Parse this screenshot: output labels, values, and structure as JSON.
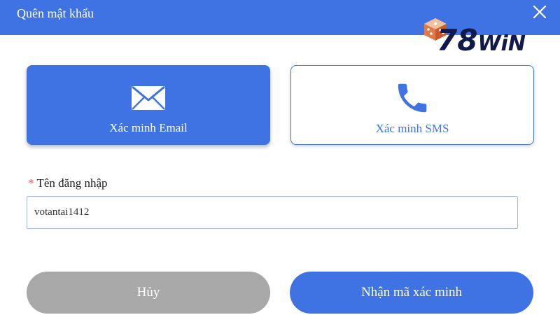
{
  "dialog": {
    "title": "Quên mật khẩu"
  },
  "logo": {
    "text_number": "78",
    "text_brand": "WiN"
  },
  "methods": {
    "email_label": "Xác minh Email",
    "sms_label": "Xác minh SMS"
  },
  "form": {
    "required_mark": "*",
    "username_label": "Tên đăng nhập",
    "username_value": "votantai1412"
  },
  "actions": {
    "cancel_label": "Hủy",
    "submit_label": "Nhận mã xác minh"
  },
  "colors": {
    "primary": "#3f73e4",
    "cancel": "#a8a8a8",
    "required": "#e05a5a",
    "logo_text": "#101a4a"
  },
  "icons": {
    "close": "close-icon",
    "email": "envelope-icon",
    "sms": "phone-icon",
    "logo": "dice-icon"
  }
}
